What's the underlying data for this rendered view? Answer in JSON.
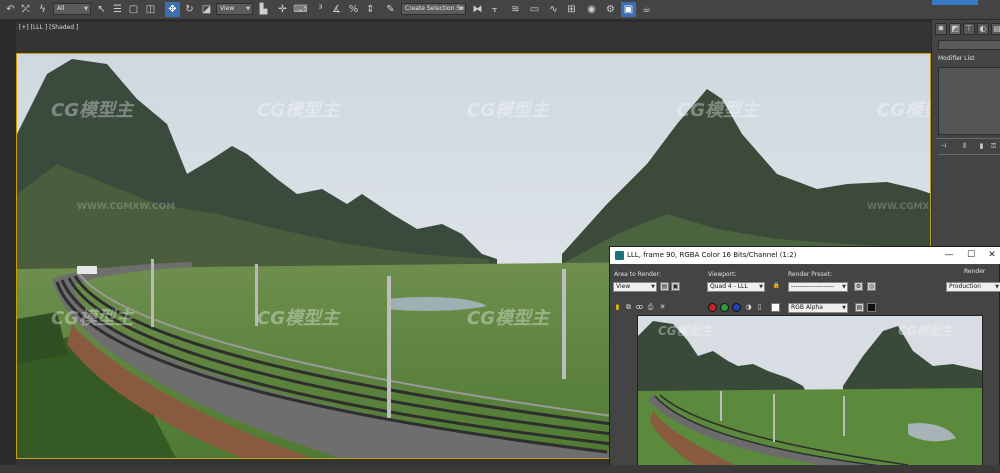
{
  "toolbar": {
    "selection_filter": "All",
    "coord_system": "View",
    "named_selection_set": "Create Selection Se",
    "icons": [
      "undo-icon",
      "redo-icon",
      "link-icon",
      "unlink-icon",
      "bind-spacewarp-icon",
      "select-filter",
      "select-object-icon",
      "select-by-name-icon",
      "rect-region-icon",
      "window-crossing-icon",
      "select-move-icon",
      "select-rotate-icon",
      "select-scale-icon",
      "ref-coord",
      "pivot-center-icon",
      "keyboard-shortcut-icon",
      "snaps-toggle-icon",
      "angle-snap-icon",
      "percent-snap-icon",
      "spinner-snap-icon",
      "edit-named-sel-icon",
      "named-sel-set",
      "mirror-icon",
      "align-icon",
      "layer-explorer-icon",
      "ribbon-icon",
      "curve-editor-icon",
      "schematic-view-icon",
      "material-editor-icon",
      "render-setup-icon",
      "rendered-frame-window-icon",
      "render-production-icon"
    ]
  },
  "viewport": {
    "label": "[+] [LLL ] [Shaded ]"
  },
  "command_panel": {
    "tabs": [
      "create-icon",
      "modify-icon",
      "hierarchy-icon",
      "motion-icon",
      "display-icon"
    ],
    "modifier_list_label": "Modifier List"
  },
  "render_window": {
    "title": "LLL, frame 90, RGBA Color 16 Bits/Channel (1:2)",
    "area_to_render_label": "Area to Render:",
    "area_to_render_value": "View",
    "viewport_label": "Viewport:",
    "viewport_value": "Quad 4 - LLL",
    "render_preset_label": "Render Preset:",
    "render_preset_value": "--------------------",
    "render_label": "Render",
    "render_mode_value": "Production",
    "channel_value": "RGB Alpha",
    "window_controls": {
      "minimize": "—",
      "maximize": "☐",
      "close": "✕"
    }
  },
  "watermark": {
    "brand": "CG模型主",
    "url": "WWW.CGMXW.COM"
  },
  "colors": {
    "accent_blue": "#3c6fb0",
    "viewport_border": "#c8a100",
    "ui_panel": "#444444"
  }
}
